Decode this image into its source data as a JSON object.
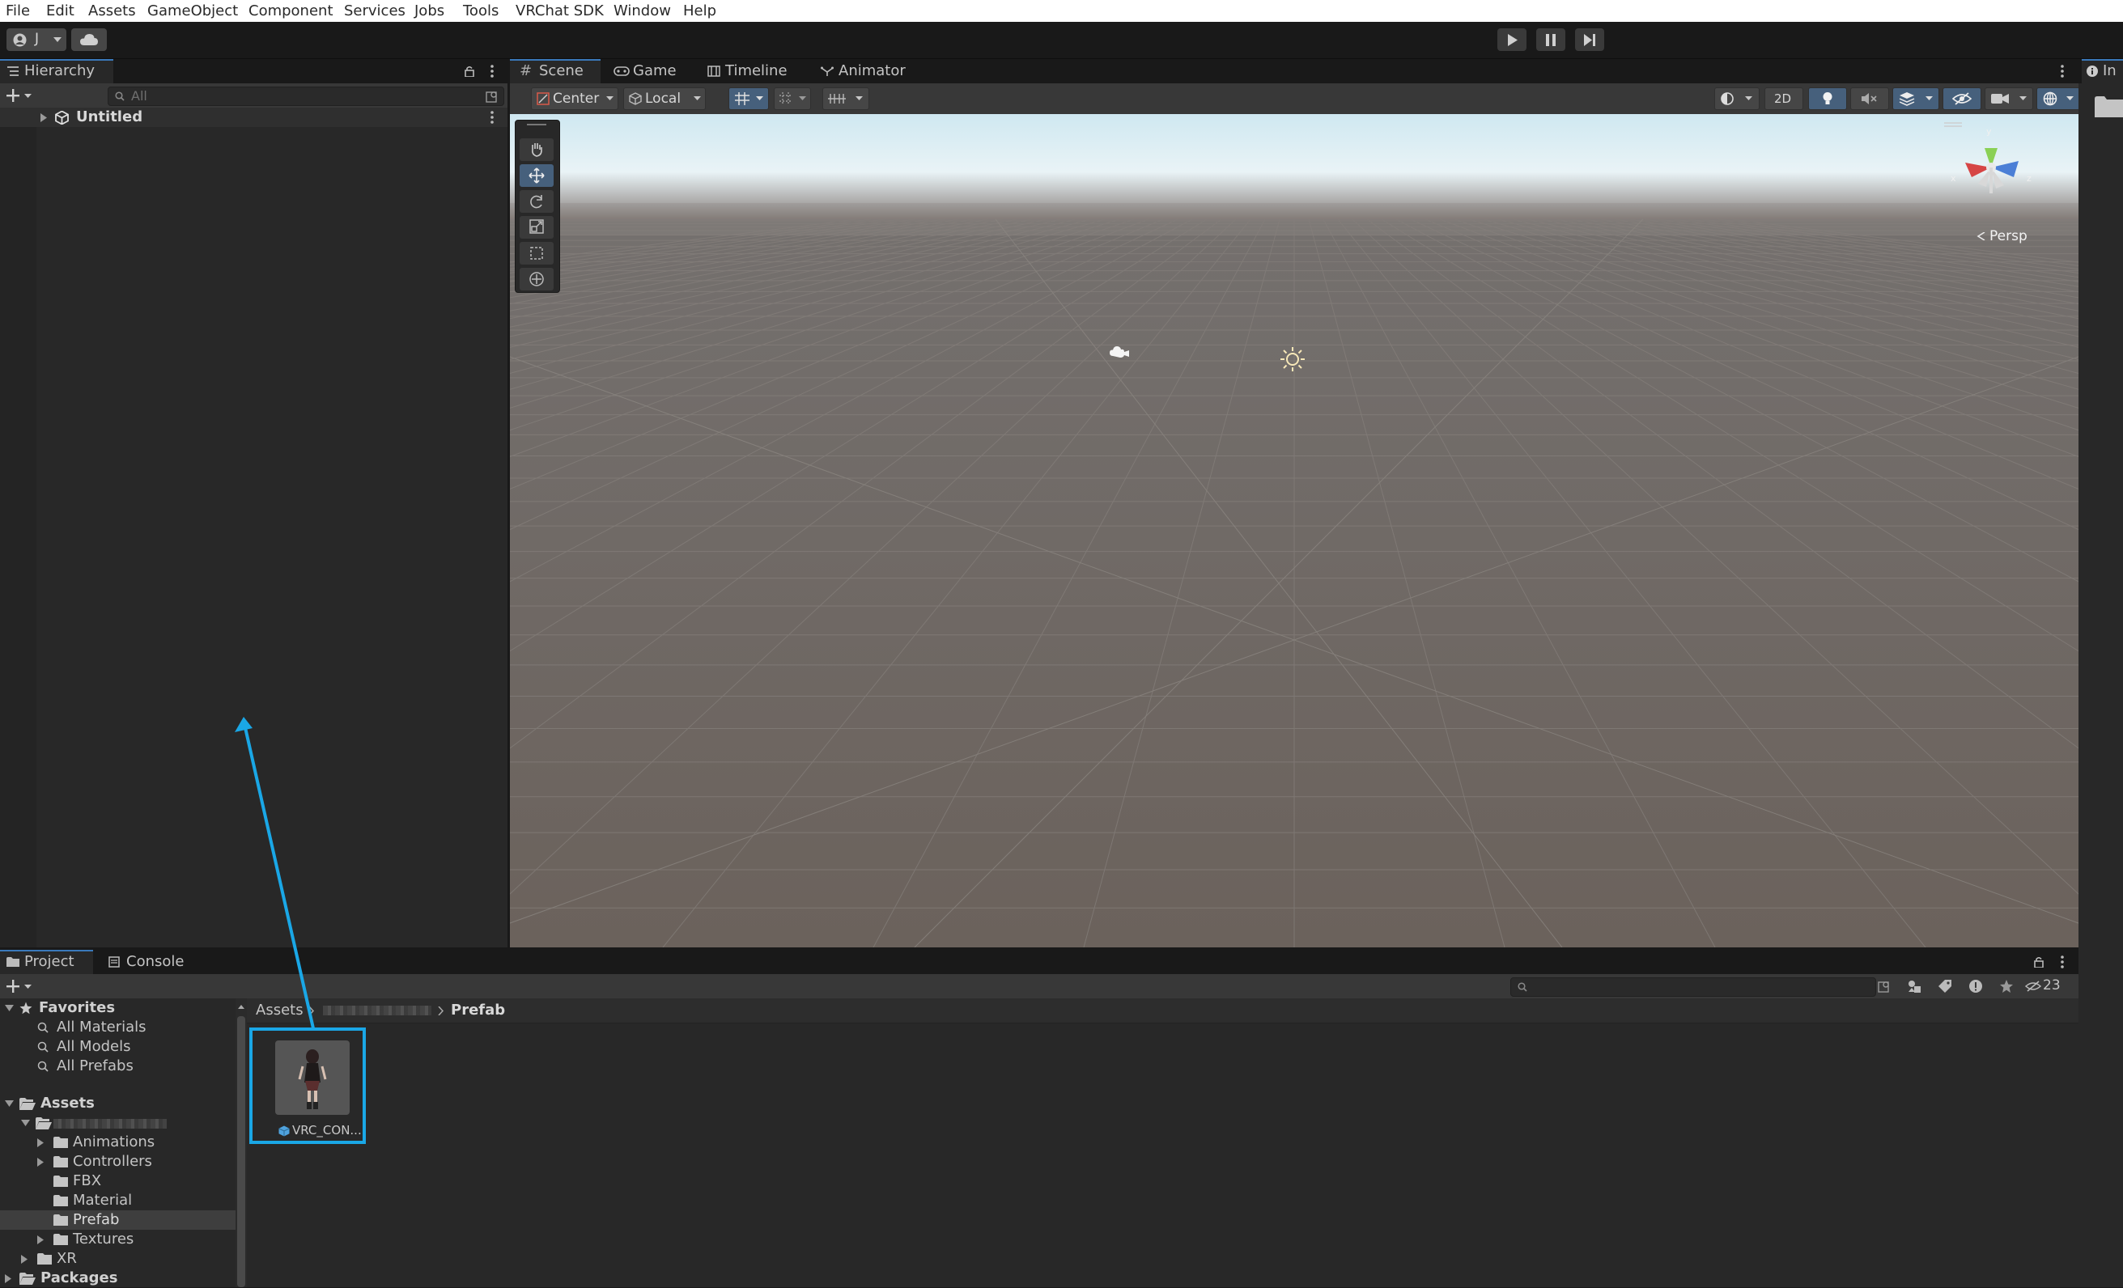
{
  "menubar": {
    "items": [
      "File",
      "Edit",
      "Assets",
      "GameObject",
      "Component",
      "Services",
      "Jobs",
      "Tools",
      "VRChat SDK",
      "Window",
      "Help"
    ]
  },
  "toolbar": {
    "account_initial": "J",
    "play_icon": "play-icon",
    "pause_icon": "pause-icon",
    "step_icon": "step-icon"
  },
  "hierarchy": {
    "tab_label": "Hierarchy",
    "search_placeholder": "All",
    "scene_name": "Untitled"
  },
  "scene": {
    "tabs": [
      "Scene",
      "Game",
      "Timeline",
      "Animator"
    ],
    "pivot_mode": "Center",
    "pivot_rotation": "Local",
    "view_2d": "2D",
    "projection_label": "Persp",
    "gizmo_axes": {
      "y": "y",
      "x": "x",
      "z": "z"
    }
  },
  "inspector": {
    "tab_label": "In"
  },
  "project": {
    "tabs": [
      "Project",
      "Console"
    ],
    "hidden_count": "23",
    "breadcrumb": {
      "root": "Assets",
      "current": "Prefab"
    },
    "favorites": {
      "label": "Favorites",
      "items": [
        "All Materials",
        "All Models",
        "All Prefabs"
      ]
    },
    "assets": {
      "label": "Assets",
      "children": [
        "Animations",
        "Controllers",
        "FBX",
        "Material",
        "Prefab",
        "Textures"
      ],
      "selected": "Prefab",
      "xr": "XR"
    },
    "packages_label": "Packages",
    "asset_item": {
      "name": "VRC_CON...",
      "type_icon": "prefab-icon"
    }
  },
  "annotation": {
    "color": "#1aa7e6"
  }
}
